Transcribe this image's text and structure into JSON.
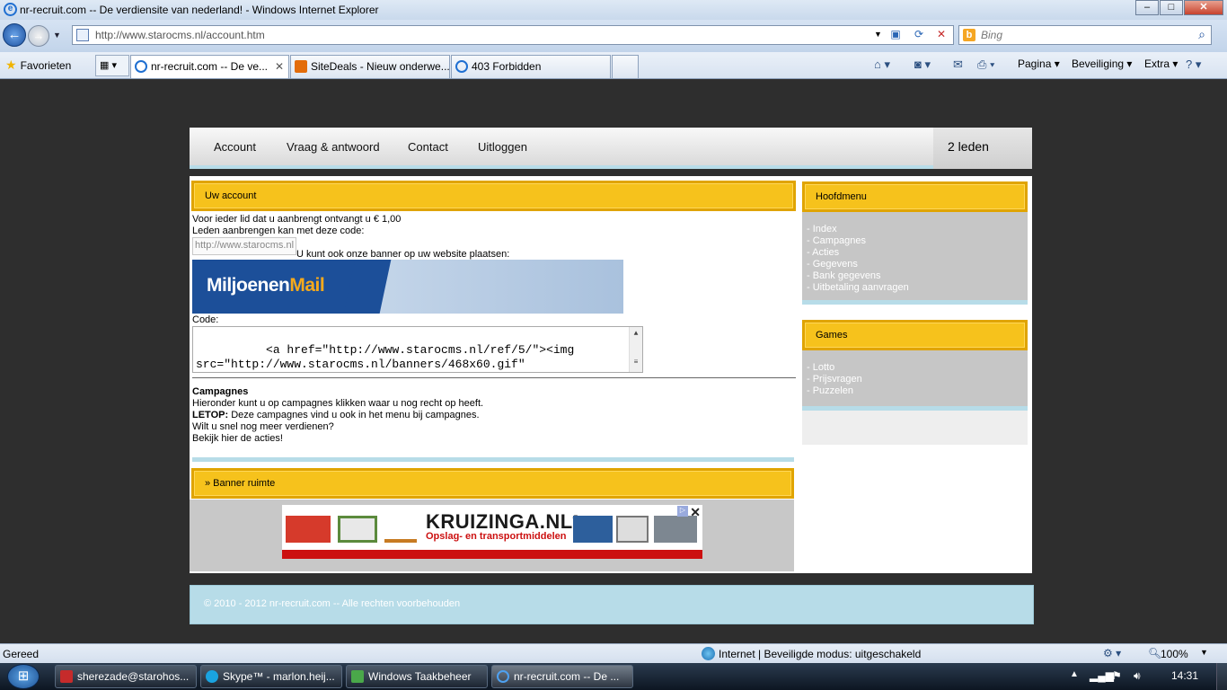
{
  "window": {
    "title": "nr-recruit.com -- De verdiensite van nederland! - Windows Internet Explorer"
  },
  "address": {
    "url": "http://www.starocms.nl/account.htm"
  },
  "search": {
    "placeholder": "Bing"
  },
  "favorites": {
    "label": "Favorieten"
  },
  "tabs": [
    {
      "label": "nr-recruit.com -- De ve...",
      "active": true
    },
    {
      "label": "SiteDeals - Nieuw onderwe...",
      "active": false
    },
    {
      "label": "403 Forbidden",
      "active": false
    }
  ],
  "toolbar": {
    "pagina": "Pagina",
    "beveiliging": "Beveiliging",
    "extra": "Extra"
  },
  "site": {
    "nav": [
      "Account",
      "Vraag & antwoord",
      "Contact",
      "Uitloggen"
    ],
    "leden": "2 leden",
    "account": {
      "heading": "Uw account",
      "line1": "Voor ieder lid dat u aanbrengt ontvangt u € 1,00",
      "line2": "Leden aanbrengen kan met deze code:",
      "ref_value": "http://www.starocms.nl",
      "banner_note": "U kunt ook onze banner op uw website plaatsen:",
      "banner_logo_a": "Miljoenen",
      "banner_logo_b": "Mail",
      "code_label": "Code:",
      "code": "<a href=\"http://www.starocms.nl/ref/5/\"><img\nsrc=\"http://www.starocms.nl/banners/468x60.gif\"\nalt=\"MiljoenenMail.nl\" /></a>"
    },
    "campagnes": {
      "title": "Campagnes",
      "line1": "Hieronder kunt u op campagnes klikken waar u nog recht op heeft.",
      "letop_label": "LETOP:",
      "letop_text": " Deze campagnes vind u ook in het menu bij campagnes.",
      "line3": "Wilt u snel nog meer verdienen?",
      "line4": "Bekijk hier de acties!"
    },
    "banner_ruimte": "» Banner ruimte",
    "ad": {
      "brand": "KRUIZINGA.NL",
      "reg": "®",
      "tagline": "Opslag- en transportmiddelen"
    },
    "hoofdmenu": {
      "heading": "Hoofdmenu",
      "items": [
        "- Index",
        "- Campagnes",
        "- Acties",
        "- Gegevens",
        "- Bank gegevens",
        "- Uitbetaling aanvragen"
      ]
    },
    "games": {
      "heading": "Games",
      "items": [
        "- Lotto",
        "- Prijsvragen",
        "- Puzzelen"
      ]
    },
    "footer": "© 2010 - 2012 nr-recruit.com -- Alle rechten voorbehouden"
  },
  "status": {
    "left": "Gereed",
    "zone": "Internet | Beveiligde modus: uitgeschakeld",
    "zoom": "100%"
  },
  "taskbar": {
    "items": [
      "sherezade@starohos...",
      "Skype™ - marlon.heij...",
      "Windows Taakbeheer",
      "nr-recruit.com -- De ..."
    ],
    "clock": "14:31"
  }
}
